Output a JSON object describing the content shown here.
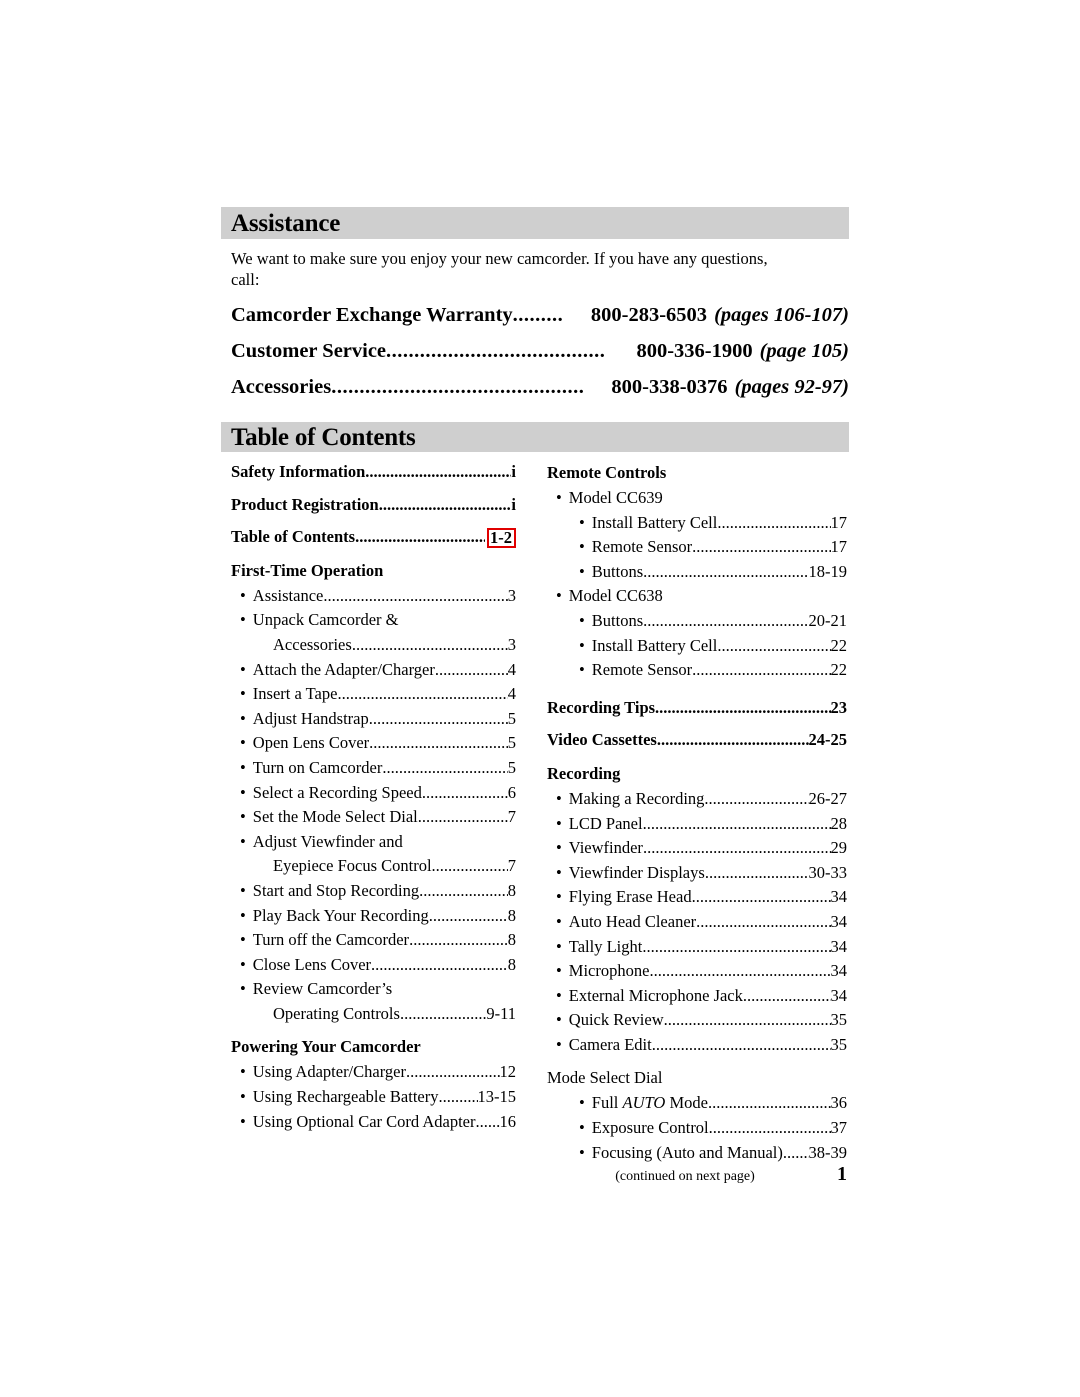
{
  "assistance": {
    "heading": "Assistance",
    "intro": "We want to make sure you enjoy your new camcorder. If you have any questions, call:",
    "phones": [
      {
        "label": "Camcorder Exchange Warranty",
        "dots": ".........",
        "number": "800-283-6503",
        "pages": "(pages 106-107)"
      },
      {
        "label": "Customer Service",
        "dots": ".......................................",
        "number": "800-336-1900",
        "pages": "(page 105)"
      },
      {
        "label": "Accessories",
        "dots": ".............................................",
        "number": "800-338-0376",
        "pages": "(pages 92-97)"
      }
    ]
  },
  "toc": {
    "heading": "Table of Contents",
    "left": [
      {
        "kind": "bold",
        "text": "Safety Information",
        "page": "i"
      },
      {
        "kind": "bold",
        "text": "Product Registration",
        "page": "i"
      },
      {
        "kind": "bold",
        "text": "Table of Contents",
        "page": "1-2",
        "highlight": true
      },
      {
        "kind": "section",
        "text": "First-Time Operation"
      },
      {
        "kind": "lvl1",
        "text": "Assistance",
        "page": "3"
      },
      {
        "kind": "lvl1",
        "text": "Unpack Camcorder &"
      },
      {
        "kind": "cont",
        "text": "Accessories",
        "page": "3"
      },
      {
        "kind": "lvl1",
        "text": "Attach the Adapter/Charger",
        "page": "4"
      },
      {
        "kind": "lvl1",
        "text": "Insert a Tape",
        "page": "4"
      },
      {
        "kind": "lvl1",
        "text": "Adjust Handstrap",
        "page": "5"
      },
      {
        "kind": "lvl1",
        "text": "Open Lens Cover",
        "page": "5"
      },
      {
        "kind": "lvl1",
        "text": "Turn on Camcorder",
        "page": "5"
      },
      {
        "kind": "lvl1",
        "text": "Select a Recording Speed",
        "page": "6"
      },
      {
        "kind": "lvl1",
        "text": "Set the Mode Select Dial",
        "page": "7"
      },
      {
        "kind": "lvl1",
        "text": "Adjust Viewfinder and"
      },
      {
        "kind": "cont",
        "text": "Eyepiece Focus Control",
        "page": "7"
      },
      {
        "kind": "lvl1",
        "text": "Start and Stop Recording",
        "page": "8"
      },
      {
        "kind": "lvl1",
        "text": "Play Back Your Recording",
        "page": "8"
      },
      {
        "kind": "lvl1",
        "text": "Turn off the Camcorder",
        "page": "8"
      },
      {
        "kind": "lvl1",
        "text": "Close Lens Cover",
        "page": "8"
      },
      {
        "kind": "lvl1",
        "text": "Review Camcorder’s"
      },
      {
        "kind": "cont",
        "text": "Operating Controls",
        "page": "9-11"
      },
      {
        "kind": "section",
        "text": "Powering Your Camcorder"
      },
      {
        "kind": "lvl1",
        "text": "Using Adapter/Charger",
        "page": "12"
      },
      {
        "kind": "lvl1",
        "text": "Using Rechargeable Battery",
        "page": "13-15"
      },
      {
        "kind": "lvl1",
        "text": "Using Optional Car Cord Adapter",
        "page": "16"
      }
    ],
    "right": [
      {
        "kind": "section",
        "text": "Remote Controls"
      },
      {
        "kind": "lvl1",
        "text": "Model CC639"
      },
      {
        "kind": "lvl2",
        "text": "Install Battery Cell",
        "page": "17"
      },
      {
        "kind": "lvl2",
        "text": "Remote Sensor",
        "page": "17"
      },
      {
        "kind": "lvl2",
        "text": "Buttons",
        "page": "18-19"
      },
      {
        "kind": "lvl1",
        "text": "Model CC638"
      },
      {
        "kind": "lvl2",
        "text": "Buttons",
        "page": "20-21"
      },
      {
        "kind": "lvl2",
        "text": "Install Battery Cell",
        "page": "22"
      },
      {
        "kind": "lvl2",
        "text": "Remote Sensor",
        "page": "22"
      },
      {
        "kind": "bold",
        "text": "Recording Tips",
        "page": "23"
      },
      {
        "kind": "bold",
        "text": "Video Cassettes",
        "page": "24-25"
      },
      {
        "kind": "section",
        "text": "Recording"
      },
      {
        "kind": "lvl1",
        "text": "Making a Recording",
        "page": "26-27"
      },
      {
        "kind": "lvl1",
        "text": "LCD Panel",
        "page": "28"
      },
      {
        "kind": "lvl1",
        "text": "Viewfinder",
        "page": "29"
      },
      {
        "kind": "lvl1",
        "text": "Viewfinder Displays",
        "page": "30-33"
      },
      {
        "kind": "lvl1",
        "text": "Flying Erase Head",
        "page": "34"
      },
      {
        "kind": "lvl1",
        "text": "Auto Head Cleaner",
        "page": "34"
      },
      {
        "kind": "lvl1",
        "text": "Tally Light",
        "page": "34"
      },
      {
        "kind": "lvl1",
        "text": "Microphone",
        "page": "34"
      },
      {
        "kind": "lvl1",
        "text": "External Microphone Jack",
        "page": "34"
      },
      {
        "kind": "lvl1",
        "text": "Quick Review",
        "page": "35"
      },
      {
        "kind": "lvl1",
        "text": "Camera Edit",
        "page": "35"
      },
      {
        "kind": "plain",
        "text": "Mode Select Dial"
      },
      {
        "kind": "lvl2",
        "text": "Full AUTO Mode",
        "italic_word": "AUTO",
        "page": "36"
      },
      {
        "kind": "lvl2",
        "text": "Exposure Control",
        "page": "37"
      },
      {
        "kind": "lvl2",
        "text": "Focusing (Auto and Manual)",
        "page": "38-39"
      }
    ]
  },
  "footer": {
    "continued": "(continued on next page)",
    "page_number": "1"
  },
  "colors": {
    "bar_gray": "#cfcfcf",
    "highlight_red": "#e00000",
    "text": "#000000"
  }
}
